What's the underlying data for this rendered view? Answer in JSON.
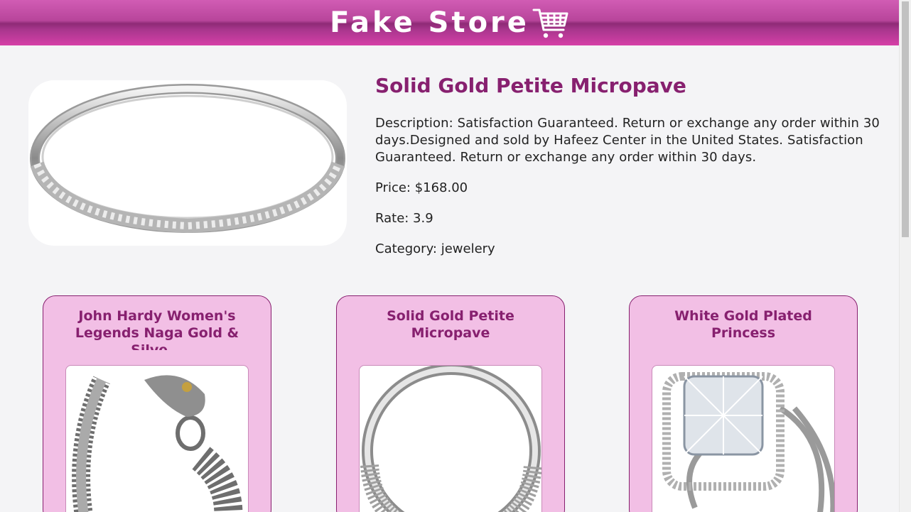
{
  "header": {
    "brand": "Fake Store",
    "icon": "shopping-cart-icon"
  },
  "product": {
    "title": "Solid Gold Petite Micropave",
    "description": "Description: Satisfaction Guaranteed. Return or exchange any order within 30 days.Designed and sold by Hafeez Center in the United States. Satisfaction Guaranteed. Return or exchange any order within 30 days.",
    "price": "Price: $168.00",
    "rate": "Rate: 3.9",
    "category": "Category: jewelery"
  },
  "related": [
    {
      "title": "John Hardy Women's Legends Naga Gold & Silve..."
    },
    {
      "title": "Solid Gold Petite Micropave"
    },
    {
      "title": "White Gold Plated Princess"
    }
  ],
  "colors": {
    "accent": "#87206f",
    "header": "#c04aa2",
    "card_bg": "#f2bfe5"
  }
}
